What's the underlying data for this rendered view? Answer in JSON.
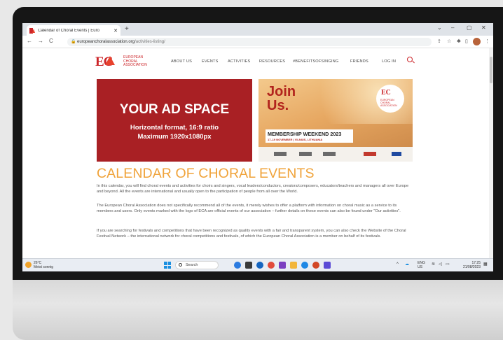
{
  "browser": {
    "tab_title": "Calendar of Choral Events | Euro",
    "tab_close": "✕",
    "new_tab": "+",
    "url_domain": "europeanchoralassociation.org",
    "url_path": "/activities-listing/",
    "nav_back": "←",
    "nav_forward": "→",
    "nav_reload": "C",
    "minimize": "⌄",
    "min2": "–",
    "maximize": "▢",
    "close": "✕"
  },
  "site": {
    "logo_letters": "EC",
    "logo_name": "EUROPEAN CHORAL ASSOCIATION",
    "menu": [
      "ABOUT US",
      "EVENTS",
      "ACTIVITIES",
      "RESOURCES",
      "#BENEFITSOFSINGING",
      "FRIENDS",
      "LOG IN"
    ]
  },
  "ad": {
    "headline": "YOUR AD SPACE",
    "line1": "Horizontal format, 16:9 ratio",
    "line2": "Maximum 1920x1080px"
  },
  "join": {
    "title1": "Join",
    "title2": "Us.",
    "band1": "MEMBERSHIP WEEKEND 2023",
    "band2": "17–19 NOVEMBER | VILNIUS, LITHUANIA",
    "seal_letters": "EC",
    "seal_name": "EUROPEAN CHORAL ASSOCIATION"
  },
  "content": {
    "heading": "CALENDAR OF CHORAL EVENTS",
    "p1": "In this calendar, you will find choral events and activities for choirs and singers, vocal leaders/conductors, creators/composers, educators/teachers and managers all over Europe and beyond. All the events are international and usually open to the participation of people from all over the World.",
    "p2": "The European Choral Association does not specifically recommend all of the events, it merely wishes to offer a platform with information on choral music as a service to its members and users. Only events marked with the logo of ECA are official events of our association – further details on these events can also be found under \"Our activities\".",
    "p3": "If you are searching for festivals and competitions that have been recognized as quality events with a fair and transparent system, you can also check the Website of the Choral Festival Network – the international network for choral competitions and festivals, of which the European Choral Association is a member on behalf of its festivals."
  },
  "taskbar": {
    "temp": "26°C",
    "weather": "Meist sonnig",
    "search": "Search",
    "lang1": "ENG",
    "lang2": "US",
    "time": "17:25",
    "date": "21/08/2023",
    "colors": {
      "win_blue": "#1b8fe0",
      "accent_red": "#cc2529",
      "heading_orange": "#f0a33a"
    }
  }
}
